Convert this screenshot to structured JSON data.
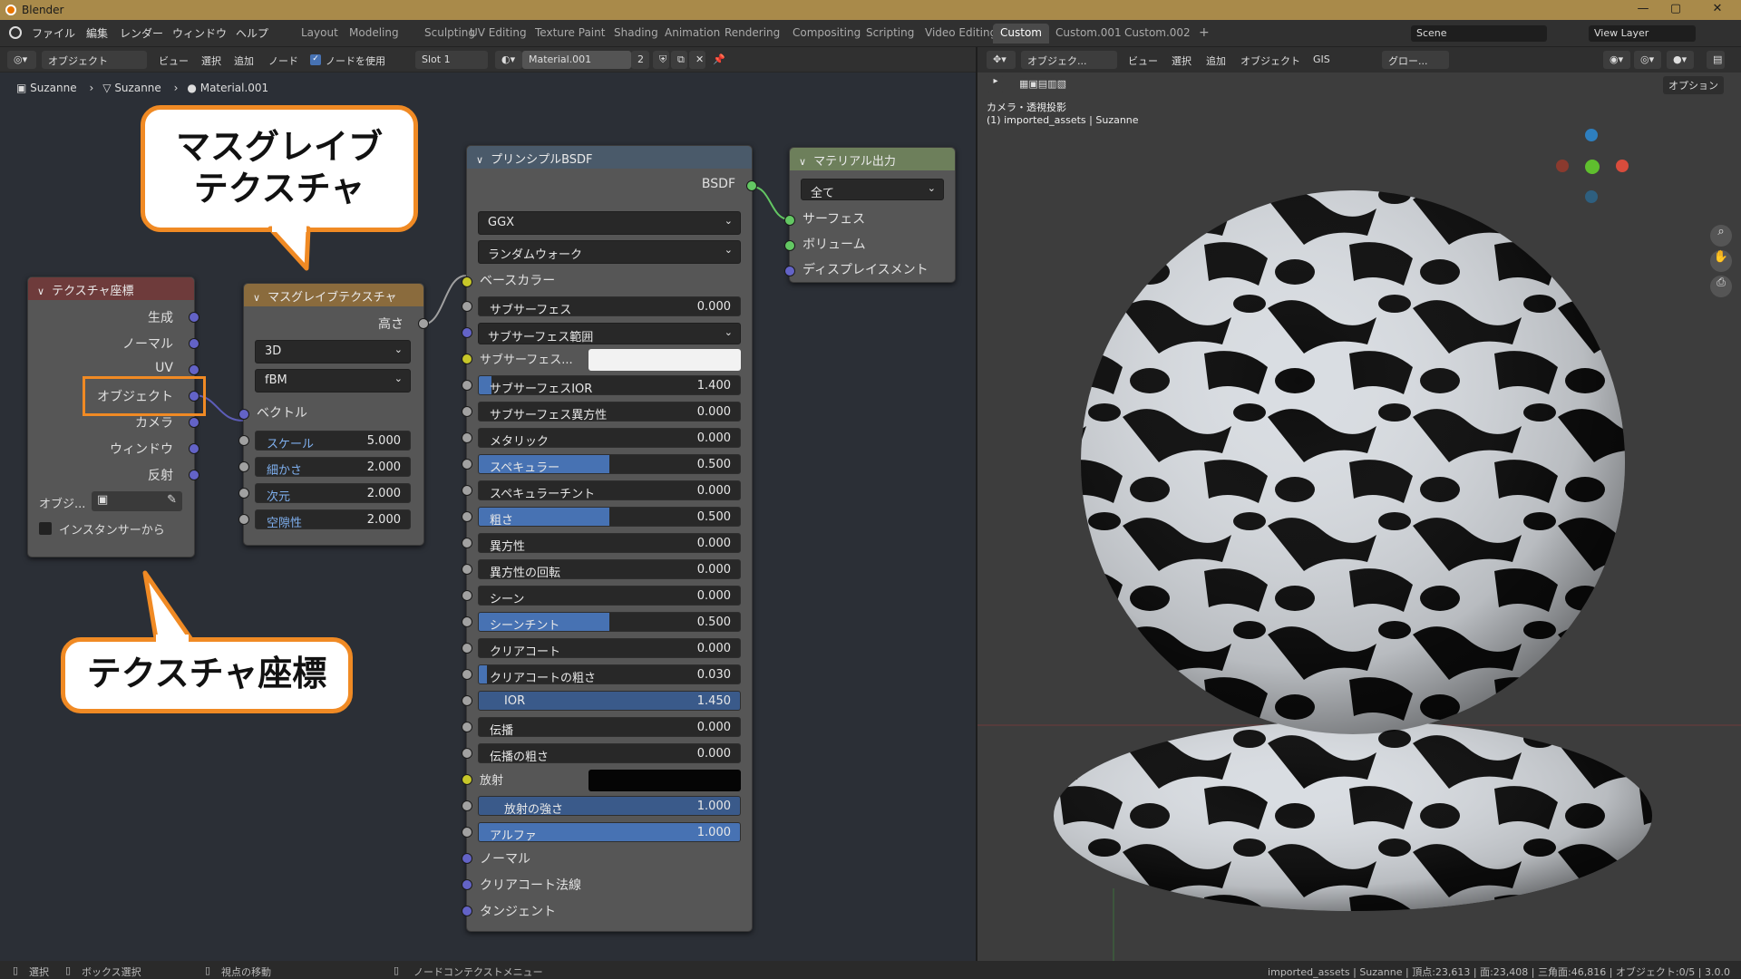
{
  "titlebar": {
    "app": "Blender"
  },
  "topbar": {
    "menus": [
      "ファイル",
      "編集",
      "レンダー",
      "ウィンドウ",
      "ヘルプ"
    ],
    "workspaces": [
      "Layout",
      "Modeling",
      "Sculpting",
      "UV Editing",
      "Texture Paint",
      "Shading",
      "Animation",
      "Rendering",
      "Compositing",
      "Scripting",
      "Video Editing",
      "Custom",
      "Custom.001",
      "Custom.002"
    ],
    "active_workspace": "Custom",
    "scene": "Scene",
    "view_layer": "View Layer"
  },
  "node_header": {
    "mode": "オブジェクト",
    "menus": [
      "ビュー",
      "選択",
      "追加",
      "ノード"
    ],
    "use_nodes": "ノードを使用",
    "slot": "Slot 1",
    "material": "Material.001",
    "users": "2"
  },
  "breadcrumb": [
    "Suzanne",
    "Suzanne",
    "Material.001"
  ],
  "nodes": {
    "texcoord": {
      "title": "テクスチャ座標",
      "outputs": [
        "生成",
        "ノーマル",
        "UV",
        "オブジェクト",
        "カメラ",
        "ウィンドウ",
        "反射"
      ],
      "object_label": "オブジ...",
      "instancer": "インスタンサーから"
    },
    "musgrave": {
      "title": "マスグレイブテクスチャ",
      "output": "高さ",
      "dim": "3D",
      "type": "fBM",
      "vector": "ベクトル",
      "fields": [
        {
          "label": "スケール",
          "value": "5.000"
        },
        {
          "label": "細かさ",
          "value": "2.000"
        },
        {
          "label": "次元",
          "value": "2.000"
        },
        {
          "label": "空隙性",
          "value": "2.000"
        }
      ]
    },
    "bsdf": {
      "title": "プリンシプルBSDF",
      "output": "BSDF",
      "dist": "GGX",
      "sss_method": "ランダムウォーク",
      "base_color": "ベースカラー",
      "rows": [
        {
          "label": "サブサーフェス",
          "value": "0.000",
          "fill": 0
        },
        {
          "label": "サブサーフェス範囲",
          "value": "",
          "fill": 0,
          "kind": "dropdown"
        },
        {
          "label": "サブサーフェス...",
          "value": "",
          "fill": 0,
          "kind": "color"
        },
        {
          "label": "サブサーフェスIOR",
          "value": "1.400",
          "fill": 0.05
        },
        {
          "label": "サブサーフェス異方性",
          "value": "0.000",
          "fill": 0
        },
        {
          "label": "メタリック",
          "value": "0.000",
          "fill": 0
        },
        {
          "label": "スペキュラー",
          "value": "0.500",
          "fill": 0.5
        },
        {
          "label": "スペキュラーチント",
          "value": "0.000",
          "fill": 0
        },
        {
          "label": "粗さ",
          "value": "0.500",
          "fill": 0.5
        },
        {
          "label": "異方性",
          "value": "0.000",
          "fill": 0
        },
        {
          "label": "異方性の回転",
          "value": "0.000",
          "fill": 0
        },
        {
          "label": "シーン",
          "value": "0.000",
          "fill": 0
        },
        {
          "label": "シーンチント",
          "value": "0.500",
          "fill": 0.5
        },
        {
          "label": "クリアコート",
          "value": "0.000",
          "fill": 0
        },
        {
          "label": "クリアコートの粗さ",
          "value": "0.030",
          "fill": 0.03
        },
        {
          "label": "IOR",
          "value": "1.450",
          "fill": 1,
          "kind": "ior"
        },
        {
          "label": "伝播",
          "value": "0.000",
          "fill": 0
        },
        {
          "label": "伝播の粗さ",
          "value": "0.000",
          "fill": 0
        },
        {
          "label": "放射",
          "value": "",
          "fill": 0,
          "kind": "emit"
        },
        {
          "label": "放射の強さ",
          "value": "1.000",
          "fill": 1,
          "kind": "ior"
        },
        {
          "label": "アルファ",
          "value": "1.000",
          "fill": 1
        },
        {
          "label": "ノーマル",
          "value": "",
          "kind": "socket"
        },
        {
          "label": "クリアコート法線",
          "value": "",
          "kind": "socket"
        },
        {
          "label": "タンジェント",
          "value": "",
          "kind": "socket"
        }
      ]
    },
    "output": {
      "title": "マテリアル出力",
      "target": "全て",
      "inputs": [
        "サーフェス",
        "ボリューム",
        "ディスプレイスメント"
      ]
    }
  },
  "callouts": {
    "musgrave": "マスグレイブ\nテクスチャ",
    "texcoord": "テクスチャ座標"
  },
  "viewport": {
    "menus": [
      "ビュー",
      "選択",
      "追加",
      "オブジェクト",
      "GIS"
    ],
    "mode": "オブジェク...",
    "orient": "グロー...",
    "camera": "カメラ・透視投影",
    "object_info": "(1) imported_assets | Suzanne",
    "options": "オプション"
  },
  "status": {
    "select": "選択",
    "box": "ボックス選択",
    "view": "視点の移動",
    "ctx": "ノードコンテクストメニュー",
    "stats": "imported_assets | Suzanne | 頂点:23,613 | 面:23,408 | 三角面:46,816 | オブジェクト:0/5 | 3.0.0"
  }
}
